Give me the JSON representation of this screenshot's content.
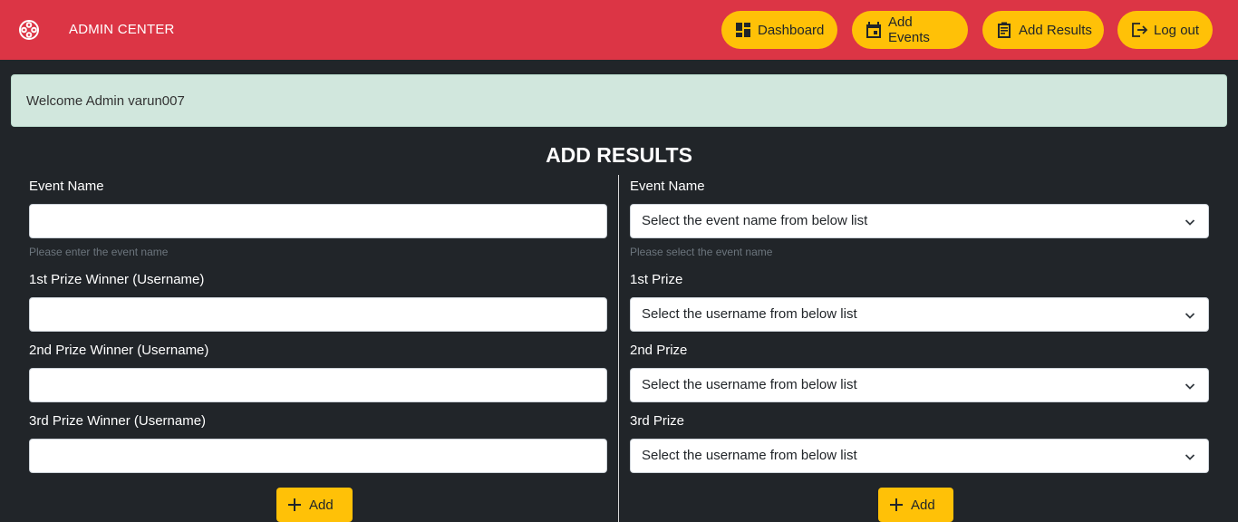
{
  "navbar": {
    "brand_icon": "film-reel-icon",
    "brand": "ADMIN CENTER",
    "buttons": [
      {
        "label": "Dashboard",
        "icon": "dashboard-icon"
      },
      {
        "label": "Add Events",
        "icon": "calendar-icon"
      },
      {
        "label": "Add Results",
        "icon": "clipboard-icon"
      },
      {
        "label": "Log out",
        "icon": "logout-icon"
      }
    ]
  },
  "alert": {
    "text": "Welcome Admin varun007"
  },
  "page": {
    "heading": "ADD RESULTS"
  },
  "left_form": {
    "event_label": "Event Name",
    "event_help": "Please enter the event name",
    "first_label": "1st Prize Winner (Username)",
    "second_label": "2nd Prize Winner (Username)",
    "third_label": "3rd Prize Winner (Username)",
    "add_label": "Add"
  },
  "right_form": {
    "event_label": "Event Name",
    "event_select": "Select the event name from below list",
    "event_help": "Please select the event name",
    "first_label": "1st Prize",
    "first_select": "Select the username from below list",
    "second_label": "2nd Prize",
    "second_select": "Select the username from below list",
    "third_label": "3rd Prize",
    "third_select": "Select the username from below list",
    "add_label": "Add"
  },
  "colors": {
    "navbar": "#dc3545",
    "accent": "#ffc107",
    "background": "#212529",
    "alert": "#d1e7dd"
  }
}
